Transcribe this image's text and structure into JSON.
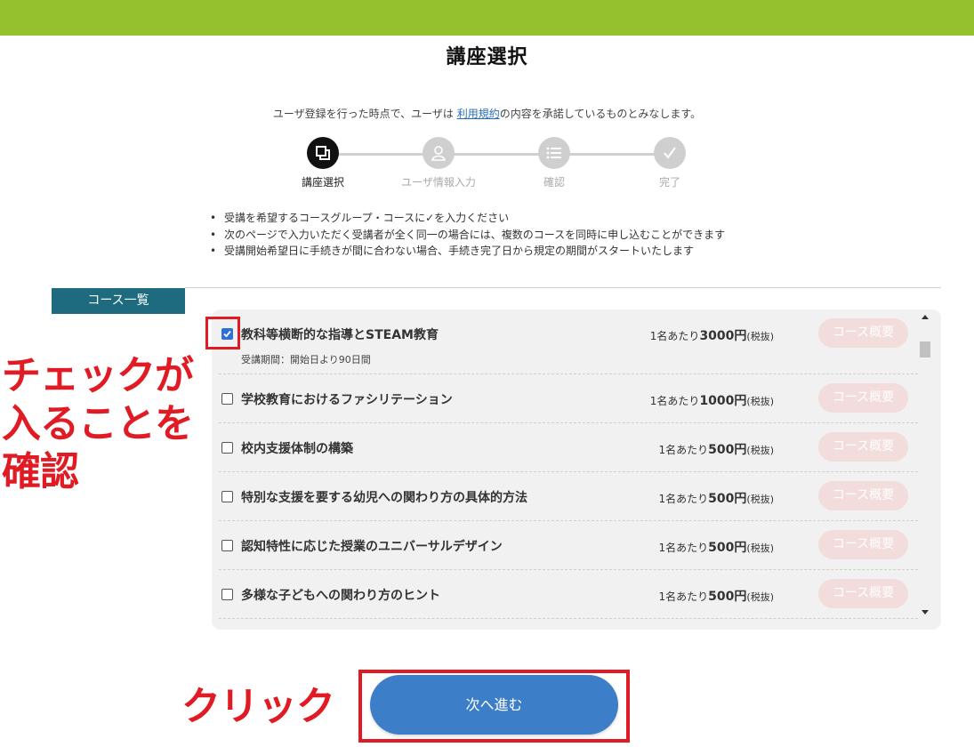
{
  "page": {
    "title": "講座選択",
    "notice_prefix": "ユーザ登録を行った時点で、ユーザは ",
    "notice_link": "利用規約",
    "notice_suffix": "の内容を承諾しているものとみなします。"
  },
  "steps": [
    {
      "label": "講座選択",
      "icon": "course-icon",
      "active": true
    },
    {
      "label": "ユーザ情報入力",
      "icon": "user-icon",
      "active": false
    },
    {
      "label": "確認",
      "icon": "list-icon",
      "active": false
    },
    {
      "label": "完了",
      "icon": "check-icon",
      "active": false
    }
  ],
  "instructions": [
    "受講を希望するコースグループ・コースに✓を入力ください",
    "次のページで入力いただく受講者が全く同一の場合には、複数のコースを同時に申し込むことができます",
    "受講開始希望日に手続きが間に合わない場合、手続き完了日から規定の期間がスタートいたします"
  ],
  "section": {
    "tab_label": "コース一覧"
  },
  "courses": [
    {
      "name": "教科等横断的な指導とSTEAM教育",
      "period": "受講期間：開始日より90日間",
      "price_prefix": "1名あたり",
      "price": "3000円",
      "tax": "(税抜)",
      "button": "コース概要",
      "checked": true
    },
    {
      "name": "学校教育におけるファシリテーション",
      "price_prefix": "1名あたり",
      "price": "1000円",
      "tax": "(税抜)",
      "button": "コース概要",
      "checked": false
    },
    {
      "name": "校内支援体制の構築",
      "price_prefix": "1名あたり",
      "price": "500円",
      "tax": "(税抜)",
      "button": "コース概要",
      "checked": false
    },
    {
      "name": "特別な支援を要する幼児への関わり方の具体的方法",
      "price_prefix": "1名あたり",
      "price": "500円",
      "tax": "(税抜)",
      "button": "コース概要",
      "checked": false
    },
    {
      "name": "認知特性に応じた授業のユニバーサルデザイン",
      "price_prefix": "1名あたり",
      "price": "500円",
      "tax": "(税抜)",
      "button": "コース概要",
      "checked": false
    },
    {
      "name": "多様な子どもへの関わり方のヒント",
      "price_prefix": "1名あたり",
      "price": "500円",
      "tax": "(税抜)",
      "button": "コース概要",
      "checked": false
    }
  ],
  "annotations": {
    "check_note": "チェックが\n入ることを\n確認",
    "click_note": "クリック"
  },
  "next_button": "次へ進む",
  "colors": {
    "header_bar": "#95c12e",
    "section_tab": "#1e6b80",
    "primary_button": "#3d7ec9",
    "annotation_red": "#e01b24",
    "overview_button": "#f3dcdc"
  }
}
